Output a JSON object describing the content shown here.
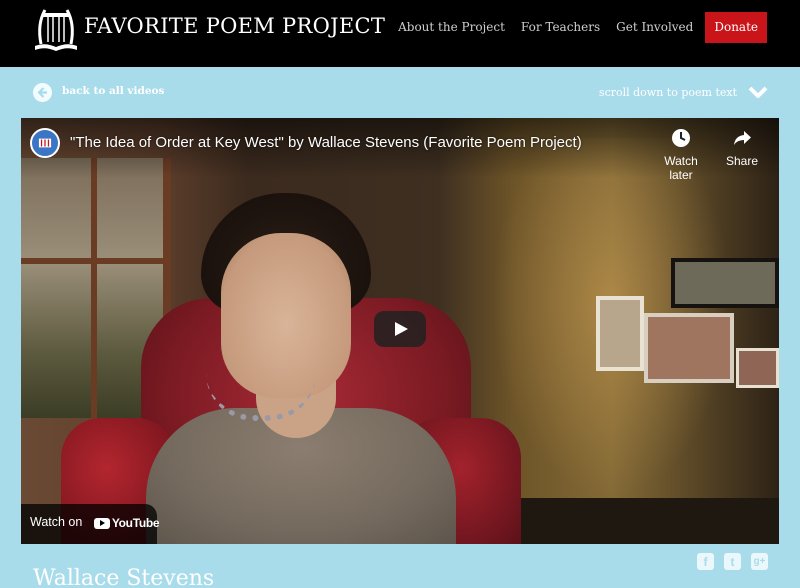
{
  "header": {
    "site_title": "FAVORITE POEM PROJECT",
    "logo_icon": "lyre-book-logo",
    "nav": [
      {
        "label": "About the Project"
      },
      {
        "label": "For Teachers"
      },
      {
        "label": "Get Involved"
      },
      {
        "label": "Donate"
      }
    ],
    "donate_color": "#c9141a"
  },
  "subbar": {
    "back_label": "back to all videos",
    "back_icon": "arrow-left-circle-icon",
    "scroll_label": "scroll down to poem text",
    "scroll_icon": "chevron-down-icon"
  },
  "video": {
    "title": "\"The Idea of Order at Key West\" by Wallace Stevens (Favorite Poem Project)",
    "watch_later_label": "Watch later",
    "share_label": "Share",
    "watch_on_label": "Watch on",
    "youtube_label": "YouTube",
    "play_icon": "play-icon"
  },
  "social": {
    "facebook": "f",
    "twitter": "t",
    "googleplus": "g+"
  },
  "poet_name": "Wallace Stevens",
  "colors": {
    "background": "#a9dcea",
    "header": "#000000",
    "accent": "#c9141a"
  }
}
